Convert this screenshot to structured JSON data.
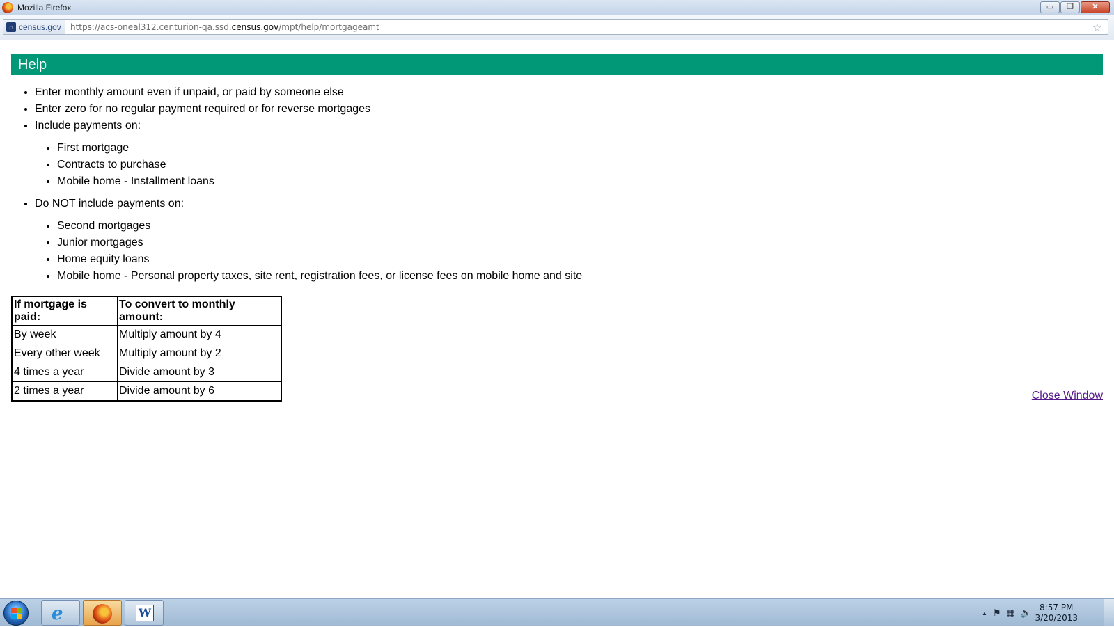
{
  "window": {
    "title": "Mozilla Firefox",
    "minimize_label": "▭",
    "restore_label": "❐",
    "close_label": "✕"
  },
  "urlbar": {
    "site_name": "census.gov",
    "url_prefix": "https://acs-oneal312.centurion-qa.ssd.",
    "url_domain": "census.gov",
    "url_path": "/mpt/help/mortgageamt",
    "star_icon": "☆"
  },
  "page": {
    "header": "Help",
    "items": [
      "Enter monthly amount even if unpaid, or paid by someone else",
      "Enter zero for no regular payment required or for reverse mortgages",
      "Include payments on:"
    ],
    "include_items": [
      "First mortgage",
      "Contracts to purchase",
      "Mobile home - Installment loans"
    ],
    "exclude_heading": "Do NOT include payments on:",
    "exclude_items": [
      "Second mortgages",
      "Junior mortgages",
      "Home equity loans",
      "Mobile home - Personal property taxes, site rent, registration fees, or license fees on mobile home and site"
    ],
    "table": {
      "headers": [
        "If mortgage is paid:",
        "To convert to monthly amount:"
      ],
      "rows": [
        [
          "By week",
          "Multiply amount by 4"
        ],
        [
          "Every other week",
          "Multiply amount by 2"
        ],
        [
          "4 times a year",
          "Divide amount by 3"
        ],
        [
          "2 times a year",
          "Divide amount by 6"
        ]
      ]
    },
    "close_link": "Close Window",
    "header_color": "#009877"
  },
  "taskbar": {
    "ie_glyph": "e",
    "word_glyph": "W",
    "tray_up": "▲",
    "tray_flag": "⚑",
    "tray_network": "▦",
    "tray_volume": "🔈",
    "time": "8:57 PM",
    "date": "3/20/2013"
  }
}
